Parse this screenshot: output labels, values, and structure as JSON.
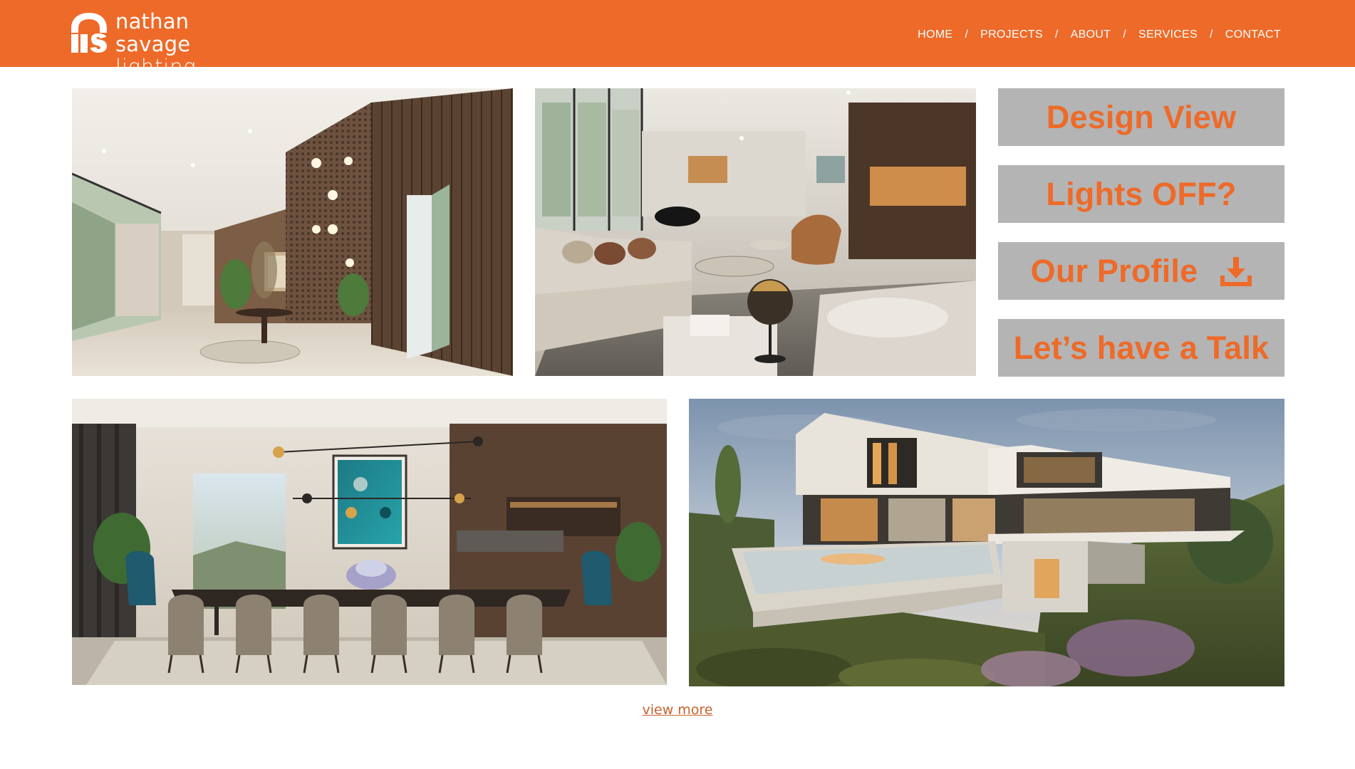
{
  "brand": {
    "line1": "nathan savage",
    "line2": "lighting design",
    "color": "#ee6a28"
  },
  "nav": {
    "items": [
      "HOME",
      "PROJECTS",
      "ABOUT",
      "SERVICES",
      "CONTACT"
    ],
    "separator": "/"
  },
  "gallery": {
    "images": [
      {
        "icon": "photo-hallway-interior"
      },
      {
        "icon": "photo-living-room"
      },
      {
        "icon": "photo-dining-room"
      },
      {
        "icon": "photo-modern-villa-exterior"
      }
    ]
  },
  "actions": {
    "design_view": "Design View",
    "lights_off": "Lights OFF?",
    "our_profile": "Our Profile",
    "lets_talk": "Let’s have a Talk",
    "profile_icon": "download-icon",
    "button_bg": "#b4b4b4"
  },
  "footer": {
    "view_more": "view more"
  }
}
